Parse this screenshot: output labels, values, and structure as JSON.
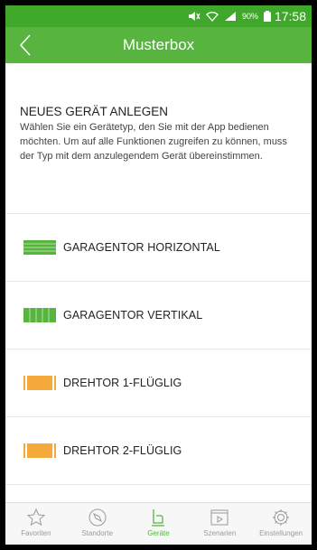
{
  "status_bar": {
    "battery_percent": "90%",
    "time": "17:58"
  },
  "header": {
    "title": "Musterbox",
    "back_icon": "chevron-left-icon"
  },
  "intro": {
    "heading": "NEUES GERÄT ANLEGEN",
    "description": "Wählen Sie ein Gerätetyp, den Sie mit der App bedienen möchten. Um auf alle Funktionen zugreifen zu können, muss der Typ mit dem anzulegendem Gerät übereinstimmen."
  },
  "device_types": [
    {
      "label": "GARAGENTOR HORIZONTAL",
      "icon": "garage-door-horizontal-icon",
      "color": "#56b43f"
    },
    {
      "label": "GARAGENTOR VERTIKAL",
      "icon": "garage-door-vertical-icon",
      "color": "#56b43f"
    },
    {
      "label": "DREHTOR 1-FLÜGLIG",
      "icon": "swing-gate-single-icon",
      "color": "#f5a93a"
    },
    {
      "label": "DREHTOR 2-FLÜGLIG",
      "icon": "swing-gate-double-icon",
      "color": "#f5a93a"
    }
  ],
  "bottom_nav": [
    {
      "label": "Favoriten",
      "icon": "star-icon",
      "active": false
    },
    {
      "label": "Standorte",
      "icon": "compass-icon",
      "active": false
    },
    {
      "label": "Geräte",
      "icon": "device-icon",
      "active": true
    },
    {
      "label": "Szenarien",
      "icon": "play-window-icon",
      "active": false
    },
    {
      "label": "Einstellungen",
      "icon": "gear-icon",
      "active": false
    }
  ],
  "colors": {
    "status_bar": "#3fa82a",
    "app_bar": "#56b43f",
    "accent": "#56b43f",
    "gate_orange": "#f5a93a"
  }
}
